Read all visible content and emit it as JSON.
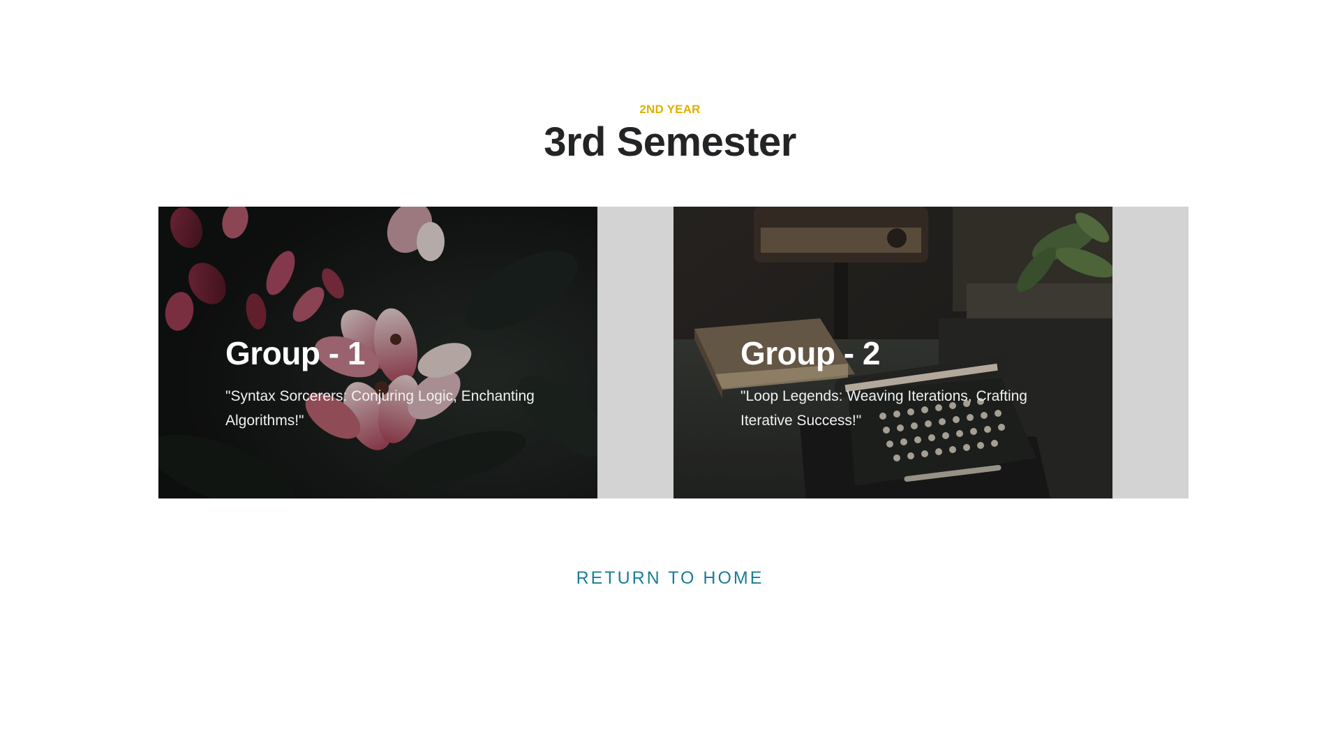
{
  "header": {
    "eyebrow": "2ND YEAR",
    "title": "3rd Semester"
  },
  "cards": [
    {
      "title": "Group - 1",
      "quote": "\"Syntax Sorcerers: Conjuring Logic, Enchanting Algorithms!\"",
      "image": "flowers-photo"
    },
    {
      "title": "Group - 2",
      "quote": "\"Loop Legends: Weaving Iterations, Crafting Iterative Success!\"",
      "image": "typewriter-photo"
    }
  ],
  "footer": {
    "return_label": "RETURN TO HOME"
  },
  "colors": {
    "eyebrow": "#e0b000",
    "title": "#222426",
    "link": "#1a7d99",
    "strip_background": "#d3d3d3"
  }
}
